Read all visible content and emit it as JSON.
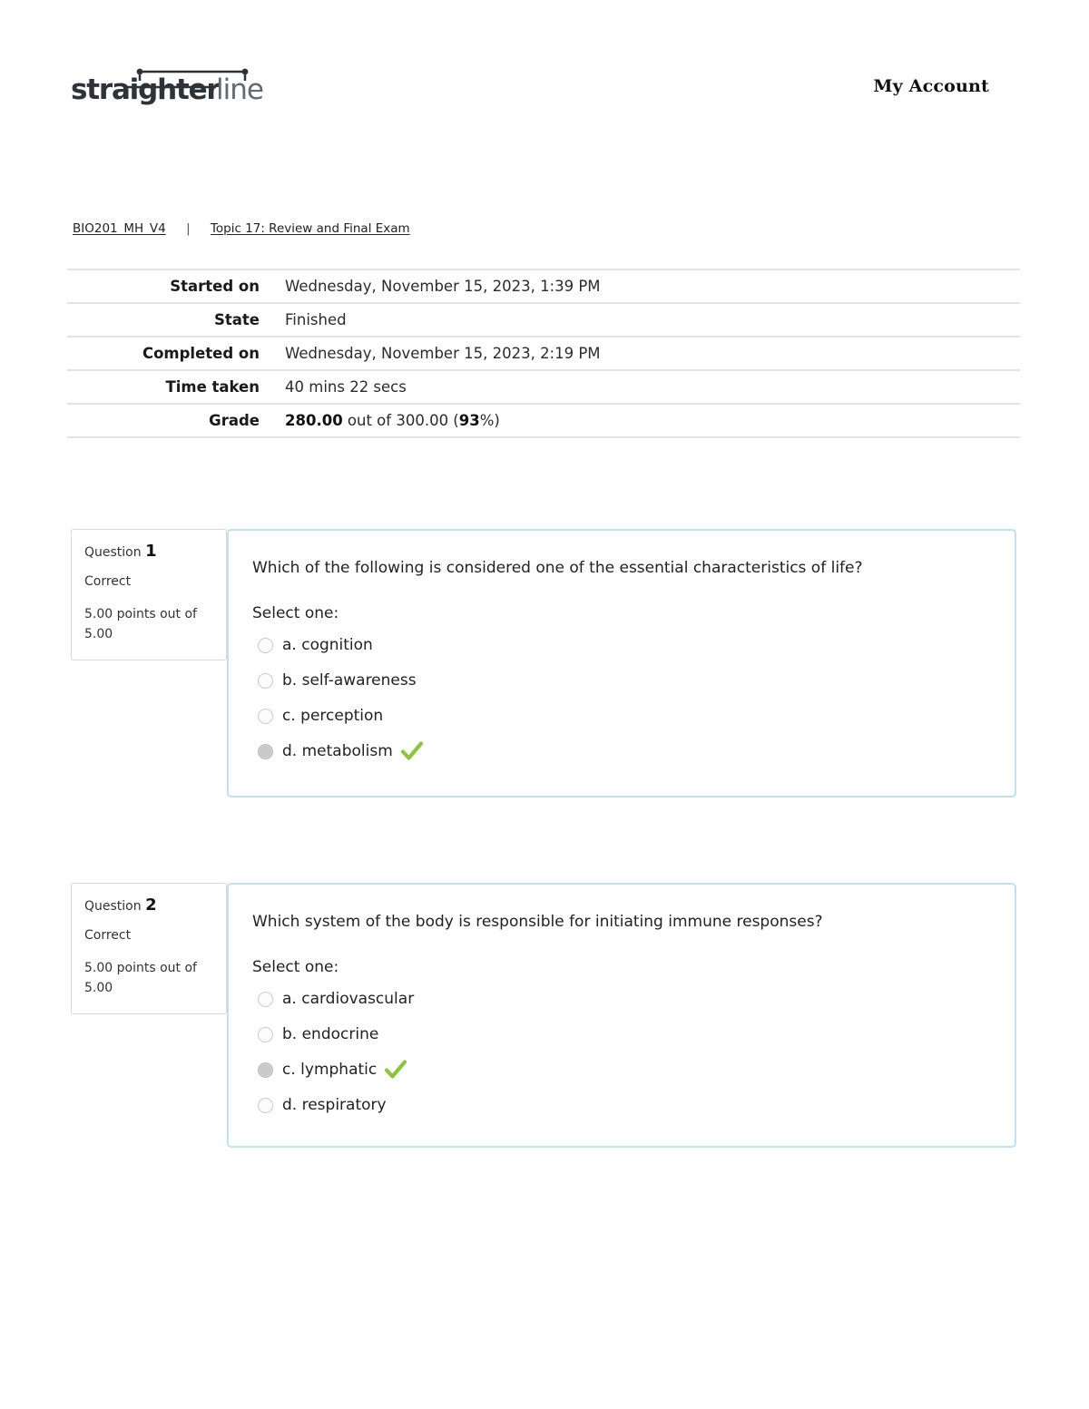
{
  "header": {
    "logo_primary": "straighter",
    "logo_secondary": "line",
    "my_account_label": "My Account"
  },
  "breadcrumb": {
    "course": "BIO201_MH_V4",
    "separator": "|",
    "topic": "Topic 17: Review and Final Exam"
  },
  "summary": {
    "rows": [
      {
        "label": "Started on",
        "value": "Wednesday, November 15, 2023, 1:39 PM"
      },
      {
        "label": "State",
        "value": "Finished"
      },
      {
        "label": "Completed on",
        "value": "Wednesday, November 15, 2023, 2:19 PM"
      },
      {
        "label": "Time taken",
        "value": "40 mins 22 secs"
      }
    ],
    "grade": {
      "label": "Grade",
      "earned": "280.00",
      "middle": " out of 300.00 (",
      "percent": "93",
      "suffix": "%)"
    }
  },
  "questions": [
    {
      "number_prefix": "Question ",
      "number": "1",
      "state": "Correct",
      "points": "5.00 points out of 5.00",
      "text": "Which of the following is considered one of the essential characteristics of life?",
      "select_prompt": "Select one:",
      "answers": [
        {
          "label": "a. cognition",
          "selected": false,
          "correct": false
        },
        {
          "label": "b. self-awareness",
          "selected": false,
          "correct": false
        },
        {
          "label": "c. perception",
          "selected": false,
          "correct": false
        },
        {
          "label": "d. metabolism",
          "selected": true,
          "correct": true
        }
      ]
    },
    {
      "number_prefix": "Question ",
      "number": "2",
      "state": "Correct",
      "points": "5.00 points out of 5.00",
      "text": "Which system of the body is responsible for initiating immune responses?",
      "select_prompt": "Select one:",
      "answers": [
        {
          "label": "a. cardiovascular",
          "selected": false,
          "correct": false
        },
        {
          "label": "b. endocrine",
          "selected": false,
          "correct": false
        },
        {
          "label": "c. lymphatic",
          "selected": true,
          "correct": true
        },
        {
          "label": "d. respiratory",
          "selected": false,
          "correct": false
        }
      ]
    }
  ],
  "colors": {
    "logo_dark": "#2d3339",
    "logo_light": "#5e6a74",
    "card_border": "#bfe2ee",
    "correct_green": "#8ac53e",
    "rule_gray": "#e3e3e3"
  }
}
